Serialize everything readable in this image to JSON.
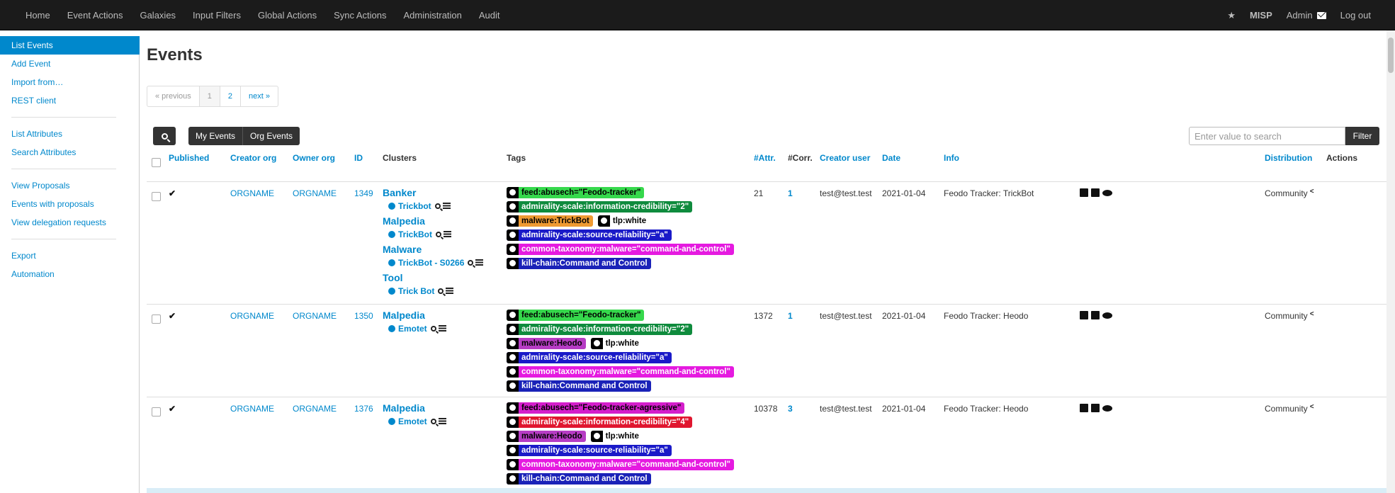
{
  "nav": {
    "items": [
      "Home",
      "Event Actions",
      "Galaxies",
      "Input Filters",
      "Global Actions",
      "Sync Actions",
      "Administration",
      "Audit"
    ],
    "right": {
      "brand": "MISP",
      "user": "Admin",
      "logout": "Log out"
    }
  },
  "sidebar": {
    "items": [
      "List Events",
      "Add Event",
      "Import from…",
      "REST client",
      "List Attributes",
      "Search Attributes",
      "View Proposals",
      "Events with proposals",
      "View delegation requests",
      "Export",
      "Automation"
    ]
  },
  "page": {
    "title": "Events"
  },
  "pagination": {
    "prev": "« previous",
    "pages": [
      "1",
      "2"
    ],
    "next": "next »"
  },
  "toolbar": {
    "my_events": "My Events",
    "org_events": "Org Events",
    "search_placeholder": "Enter value to search",
    "filter": "Filter"
  },
  "table": {
    "headers": {
      "published": "Published",
      "creator_org": "Creator org",
      "owner_org": "Owner org",
      "id": "ID",
      "clusters": "Clusters",
      "tags": "Tags",
      "attr": "#Attr.",
      "corr": "#Corr.",
      "creator_user": "Creator user",
      "date": "Date",
      "info": "Info",
      "distribution": "Distribution",
      "actions": "Actions"
    },
    "rows": [
      {
        "published": "✔",
        "creator_org": "ORGNAME",
        "owner_org": "ORGNAME",
        "id": "1349",
        "clusters": [
          {
            "type": "Banker",
            "value": "Trickbot"
          },
          {
            "type": "Malpedia",
            "value": "TrickBot"
          },
          {
            "type": "Malware",
            "value": "TrickBot - S0266"
          },
          {
            "type": "Tool",
            "value": "Trick Bot"
          }
        ],
        "tags": [
          [
            {
              "text": "feed:abusech=\"Feodo-tracker\"",
              "bg": "#36d84c",
              "fg": "#000000"
            }
          ],
          [
            {
              "text": "admirality-scale:information-credibility=\"2\"",
              "bg": "#0f8b3d",
              "fg": "#ffffff"
            }
          ],
          [
            {
              "text": "malware:TrickBot",
              "bg": "#ef9a32",
              "fg": "#000000"
            },
            {
              "text": "tlp:white",
              "bg": "#ffffff",
              "fg": "#000000"
            }
          ],
          [
            {
              "text": "admirality-scale:source-reliability=\"a\"",
              "bg": "#1a1ac8",
              "fg": "#ffffff"
            }
          ],
          [
            {
              "text": "common-taxonomy:malware=\"command-and-control\"",
              "bg": "#e51ae0",
              "fg": "#ffffff"
            }
          ],
          [
            {
              "text": "kill-chain:Command and Control",
              "bg": "#1a22b8",
              "fg": "#ffffff"
            }
          ]
        ],
        "attr": "21",
        "corr": "1",
        "creator_user": "test@test.test",
        "date": "2021-01-04",
        "info": "Feodo Tracker: TrickBot",
        "distribution": "Community"
      },
      {
        "published": "✔",
        "creator_org": "ORGNAME",
        "owner_org": "ORGNAME",
        "id": "1350",
        "clusters": [
          {
            "type": "Malpedia",
            "value": "Emotet"
          }
        ],
        "tags": [
          [
            {
              "text": "feed:abusech=\"Feodo-tracker\"",
              "bg": "#36d84c",
              "fg": "#000000"
            }
          ],
          [
            {
              "text": "admirality-scale:information-credibility=\"2\"",
              "bg": "#0f8b3d",
              "fg": "#ffffff"
            }
          ],
          [
            {
              "text": "malware:Heodo",
              "bg": "#b63cc4",
              "fg": "#000000"
            },
            {
              "text": "tlp:white",
              "bg": "#ffffff",
              "fg": "#000000"
            }
          ],
          [
            {
              "text": "admirality-scale:source-reliability=\"a\"",
              "bg": "#1a1ac8",
              "fg": "#ffffff"
            }
          ],
          [
            {
              "text": "common-taxonomy:malware=\"command-and-control\"",
              "bg": "#e51ae0",
              "fg": "#ffffff"
            }
          ],
          [
            {
              "text": "kill-chain:Command and Control",
              "bg": "#1a22b8",
              "fg": "#ffffff"
            }
          ]
        ],
        "attr": "1372",
        "corr": "1",
        "creator_user": "test@test.test",
        "date": "2021-01-04",
        "info": "Feodo Tracker: Heodo",
        "distribution": "Community"
      },
      {
        "published": "✔",
        "creator_org": "ORGNAME",
        "owner_org": "ORGNAME",
        "id": "1376",
        "clusters": [
          {
            "type": "Malpedia",
            "value": "Emotet"
          }
        ],
        "tags": [
          [
            {
              "text": "feed:abusech=\"Feodo-tracker-agressive\"",
              "bg": "#d41ecb",
              "fg": "#000000"
            }
          ],
          [
            {
              "text": "admirality-scale:information-credibility=\"4\"",
              "bg": "#e0162f",
              "fg": "#ffffff"
            }
          ],
          [
            {
              "text": "malware:Heodo",
              "bg": "#b63cc4",
              "fg": "#000000"
            },
            {
              "text": "tlp:white",
              "bg": "#ffffff",
              "fg": "#000000"
            }
          ],
          [
            {
              "text": "admirality-scale:source-reliability=\"a\"",
              "bg": "#1a1ac8",
              "fg": "#ffffff"
            }
          ],
          [
            {
              "text": "common-taxonomy:malware=\"command-and-control\"",
              "bg": "#e51ae0",
              "fg": "#ffffff"
            }
          ],
          [
            {
              "text": "kill-chain:Command and Control",
              "bg": "#1a22b8",
              "fg": "#ffffff"
            }
          ]
        ],
        "attr": "10378",
        "corr": "3",
        "creator_user": "test@test.test",
        "date": "2021-01-04",
        "info": "Feodo Tracker: Heodo",
        "distribution": "Community"
      }
    ]
  }
}
